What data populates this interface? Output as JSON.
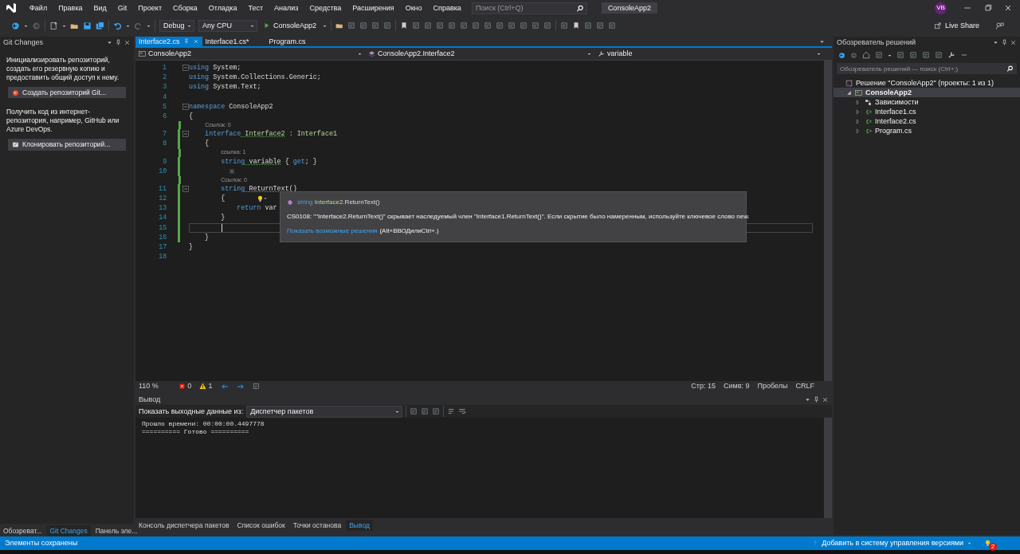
{
  "menu": {
    "items": [
      "Файл",
      "Правка",
      "Вид",
      "Git",
      "Проект",
      "Сборка",
      "Отладка",
      "Тест",
      "Анализ",
      "Средства",
      "Расширения",
      "Окно",
      "Справка"
    ],
    "search": {
      "placeholder": "Поиск (Ctrl+Q)"
    },
    "solution_title": "ConsoleApp2",
    "avatar": "VB"
  },
  "toolbar": {
    "configuration": "Debug",
    "platform": "Any CPU",
    "run_target": "ConsoleApp2",
    "live_share": "Live Share"
  },
  "git_panel": {
    "title": "Git Changes",
    "init_text": "Инициализировать репозиторий, создать его резервную копию и предоставить общий доступ к нему.",
    "create_button": "Создать репозиторий Git...",
    "clone_text": "Получить код из интернет-репозитория, например, GitHub или Azure DevOps.",
    "clone_button": "Клонировать репозиторий..."
  },
  "left_tabs": [
    {
      "label": "Обозреват...",
      "selected": false
    },
    {
      "label": "Git Changes",
      "selected": true
    },
    {
      "label": "Панель эле...",
      "selected": false
    }
  ],
  "editor": {
    "tabs": [
      {
        "label": "Interface2.cs",
        "selected": true
      },
      {
        "label": "Interface1.cs*",
        "selected": false
      },
      {
        "label": "Program.cs",
        "selected": false
      }
    ],
    "nav": {
      "project": "ConsoleApp2",
      "type": "ConsoleApp2.Interface2",
      "member": "variable"
    },
    "lines": [
      {
        "kind": "code",
        "number": "1",
        "fold": true,
        "changed": false,
        "current": false,
        "tokens": [
          {
            "text": "using",
            "kind": "keyword"
          },
          {
            "text": " System;",
            "kind": "plain"
          }
        ]
      },
      {
        "kind": "code",
        "number": "2",
        "fold": false,
        "changed": false,
        "current": false,
        "tokens": [
          {
            "text": "using",
            "kind": "keyword"
          },
          {
            "text": " System.Collections.Generic;",
            "kind": "plain"
          }
        ]
      },
      {
        "kind": "code",
        "number": "3",
        "fold": false,
        "changed": false,
        "current": false,
        "tokens": [
          {
            "text": "using",
            "kind": "keyword"
          },
          {
            "text": " System.Text;",
            "kind": "plain"
          }
        ]
      },
      {
        "kind": "code",
        "number": "4",
        "fold": false,
        "changed": false,
        "current": false
      },
      {
        "kind": "code",
        "number": "5",
        "fold": true,
        "changed": false,
        "current": false,
        "tokens": [
          {
            "text": "namespace",
            "kind": "keyword"
          },
          {
            "text": " ConsoleApp2",
            "kind": "plain"
          }
        ]
      },
      {
        "kind": "code",
        "number": "6",
        "fold": false,
        "changed": false,
        "current": false,
        "tokens": [
          {
            "text": "{",
            "kind": "plain"
          }
        ]
      },
      {
        "kind": "codelens",
        "text": "Ссылок: 0",
        "changed": true
      },
      {
        "kind": "code",
        "number": "7",
        "fold": true,
        "changed": true,
        "current": false,
        "tokens": [
          {
            "text": "    interface",
            "kind": "keyword"
          },
          {
            "text": " Interface2",
            "kind": "interface",
            "squiggle": true
          },
          {
            "text": " : Interface1",
            "kind": "interface"
          }
        ]
      },
      {
        "kind": "code",
        "number": "8",
        "fold": false,
        "changed": true,
        "current": false,
        "tokens": [
          {
            "text": "    {",
            "kind": "plain"
          }
        ]
      },
      {
        "kind": "codelens",
        "text": "ссылка: 1",
        "changed": true
      },
      {
        "kind": "code",
        "number": "9",
        "fold": false,
        "changed": true,
        "current": false,
        "tokens": [
          {
            "text": "        string",
            "kind": "keyword"
          },
          {
            "text": " variable",
            "kind": "plain",
            "squiggle": true
          },
          {
            "text": " { ",
            "kind": "plain"
          },
          {
            "text": "get",
            "kind": "keyword"
          },
          {
            "text": "; }",
            "kind": "plain"
          }
        ]
      },
      {
        "kind": "code",
        "number": "10",
        "fold": false,
        "changed": true,
        "current": false,
        "quick_action": true
      },
      {
        "kind": "codelens",
        "text": "Ссылок: 0",
        "changed": true
      },
      {
        "kind": "code",
        "number": "11",
        "fold": true,
        "changed": true,
        "current": false,
        "tokens": [
          {
            "text": "        string",
            "kind": "keyword"
          },
          {
            "text": " ReturnText",
            "kind": "plain",
            "squiggle": true
          },
          {
            "text": "()",
            "kind": "plain"
          }
        ]
      },
      {
        "kind": "code",
        "number": "12",
        "fold": false,
        "changed": true,
        "current": false,
        "lightbulb": true,
        "tokens": [
          {
            "text": "        {",
            "kind": "plain"
          }
        ]
      },
      {
        "kind": "code",
        "number": "13",
        "fold": false,
        "changed": true,
        "current": false,
        "tokens": [
          {
            "text": "            return",
            "kind": "keyword"
          },
          {
            "text": " var",
            "kind": "plain"
          }
        ]
      },
      {
        "kind": "code",
        "number": "14",
        "fold": false,
        "changed": true,
        "current": false,
        "tokens": [
          {
            "text": "        }",
            "kind": "plain"
          }
        ]
      },
      {
        "kind": "code",
        "number": "15",
        "fold": false,
        "changed": true,
        "current": true
      },
      {
        "kind": "code",
        "number": "16",
        "fold": false,
        "changed": true,
        "current": false,
        "tokens": [
          {
            "text": "    }",
            "kind": "plain"
          }
        ]
      },
      {
        "kind": "code",
        "number": "17",
        "fold": false,
        "changed": false,
        "current": false,
        "tokens": [
          {
            "text": "}",
            "kind": "plain"
          }
        ]
      },
      {
        "kind": "code",
        "number": "18",
        "fold": false,
        "changed": false,
        "current": false
      }
    ],
    "tooltip": {
      "signature": [
        {
          "text": "string",
          "kind": "keyword"
        },
        {
          "text": " Interface2",
          "kind": "interface"
        },
        {
          "text": ".ReturnText()",
          "kind": "plain"
        }
      ],
      "message": "CS0108: \"\"Interface2.ReturnText()\" скрывает наследуемый член \"Interface1.ReturnText()\". Если скрытие было намеренным, используйте ключевое слово new.",
      "link": "Показать возможные решения",
      "shortcut": "(Alt+ВВОДилиCtrl+.)"
    },
    "status": {
      "zoom": "110 %",
      "errors": "0",
      "warnings": "1",
      "line": "Стр: 15",
      "column": "Симв: 9",
      "indentation": "Пробелы",
      "line_endings": "CRLF"
    }
  },
  "output": {
    "title": "Вывод",
    "source_label": "Показать выходные данные из:",
    "source": "Диспетчер пакетов",
    "lines": [
      "Прошло времени: 00:00:00.4497778",
      "========== Готово =========="
    ]
  },
  "bottom_tabs": [
    {
      "label": "Консоль диспетчера пакетов",
      "selected": false
    },
    {
      "label": "Список ошибок",
      "selected": false
    },
    {
      "label": "Точки останова",
      "selected": false
    },
    {
      "label": "Вывод",
      "selected": true
    }
  ],
  "solution_explorer": {
    "title": "Обозреватель решений",
    "search": {
      "placeholder": "Обозреватель решений — поиск (Ctrl+;)"
    },
    "tree": [
      {
        "label": "Решение \"ConsoleApp2\" (проекты: 1 из 1)",
        "kind": "solution",
        "selected": false,
        "children": [
          {
            "label": "ConsoleApp2",
            "kind": "project",
            "expanded": true,
            "selected": true,
            "children": [
              {
                "label": "Зависимости",
                "kind": "dependencies",
                "expanded": false,
                "selected": false
              },
              {
                "label": "Interface1.cs",
                "kind": "csfile",
                "expanded": false,
                "selected": false
              },
              {
                "label": "Interface2.cs",
                "kind": "csfile",
                "expanded": false,
                "selected": false
              },
              {
                "label": "Program.cs",
                "kind": "csfile",
                "expanded": false,
                "selected": false
              }
            ]
          }
        ]
      }
    ]
  },
  "status_bar": {
    "message": "Элементы сохранены",
    "source_control": "Добавить в систему управления версиями",
    "notifications": "2"
  }
}
